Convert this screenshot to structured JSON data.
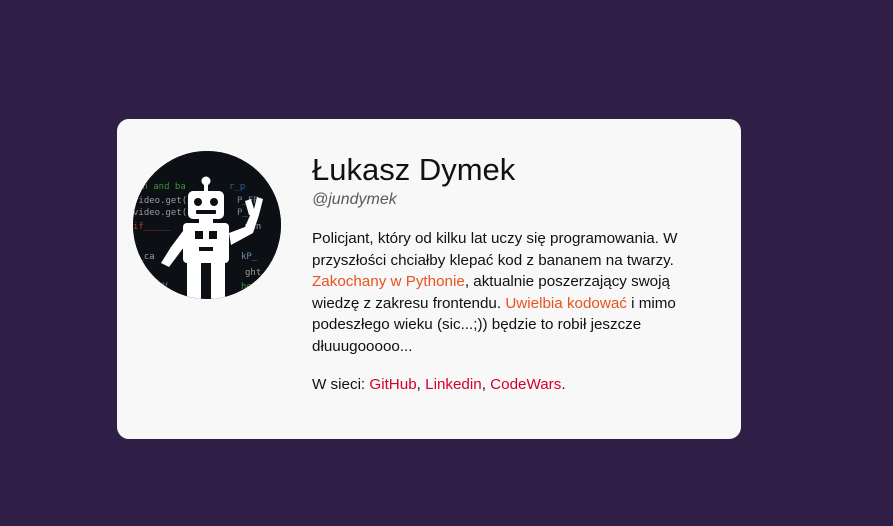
{
  "profile": {
    "name": "Łukasz Dymek",
    "handle": "@jundymek",
    "avatar_icon": "robot-avatar-icon",
    "bio": {
      "part1": "Policjant, który od kilku lat uczy się programowania. W przyszłości chciałby klepać kod z bananem na twarzy. ",
      "highlight1": "Zakochany w Pythonie",
      "part2": ", aktualnie poszerzający swoją wiedzę z zakresu frontendu. ",
      "highlight2": "Uwielbia kodować",
      "part3": " i mimo podeszłego wieku (sic...;)) będzie to robił jeszcze dłuuugooooo..."
    },
    "social": {
      "prefix": "W sieci: ",
      "links": [
        "GitHub",
        "Linkedin",
        "CodeWars"
      ],
      "sep1": ", ",
      "sep2": ", ",
      "suffix": "."
    }
  },
  "colors": {
    "background": "#2f1f46",
    "card": "#f8f8f8",
    "highlight": "#e8531f",
    "link": "#d4002a"
  }
}
